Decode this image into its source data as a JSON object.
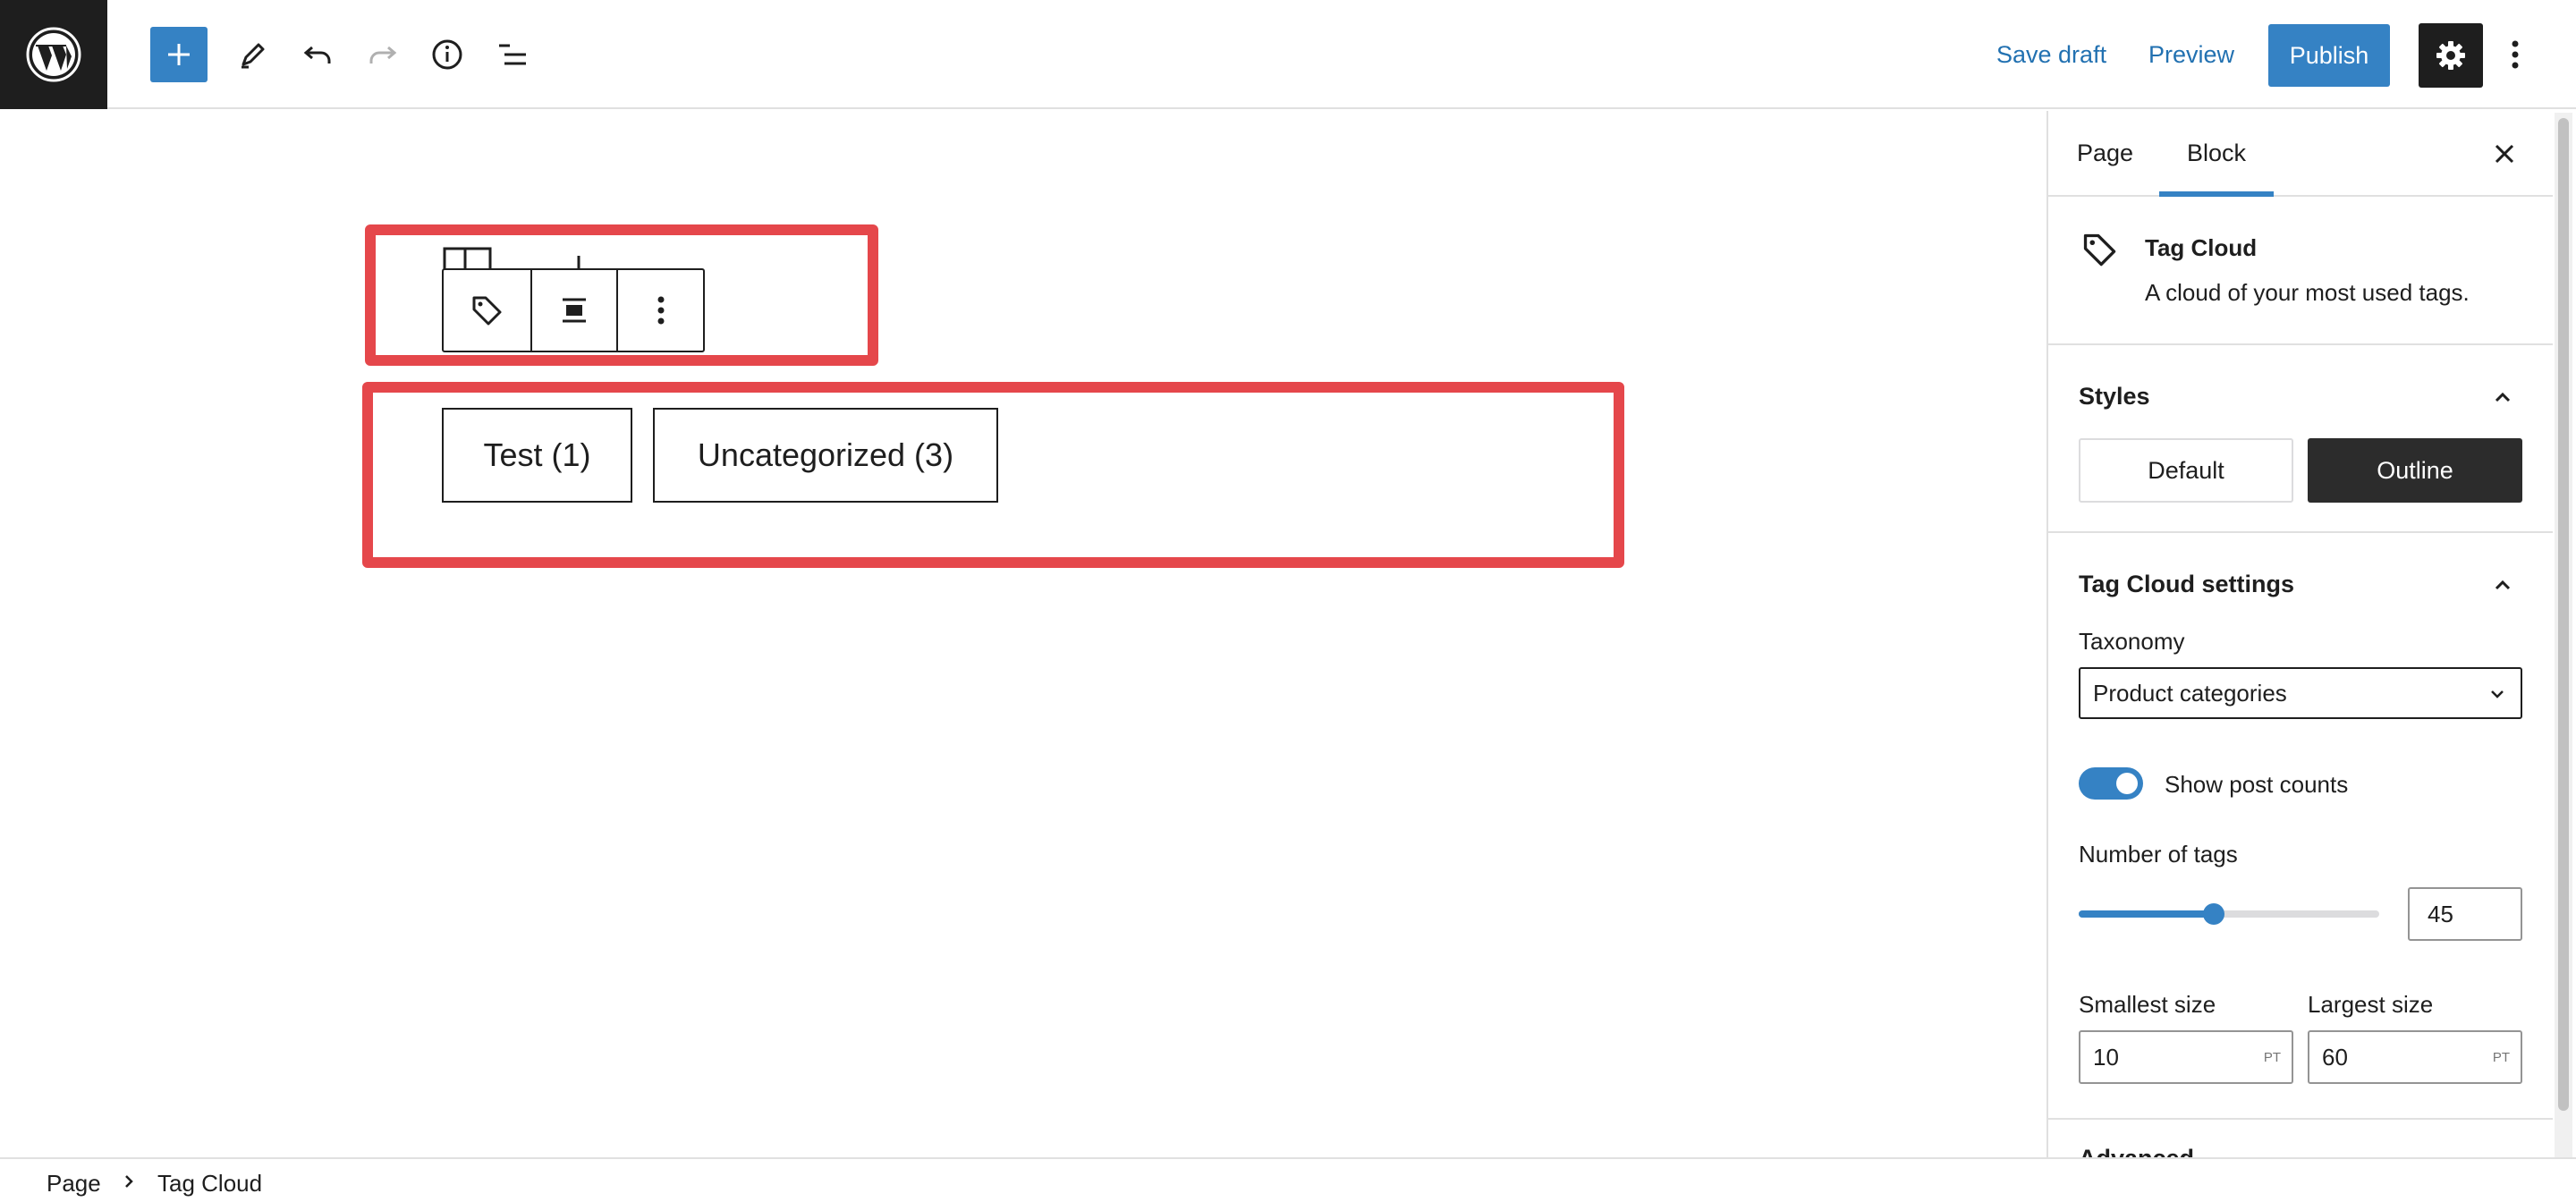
{
  "header": {
    "save_draft": "Save draft",
    "preview": "Preview",
    "publish": "Publish"
  },
  "canvas": {
    "tags": [
      {
        "label": "Test (1)"
      },
      {
        "label": "Uncategorized (3)"
      }
    ]
  },
  "sidebar": {
    "tabs": [
      {
        "label": "Page"
      },
      {
        "label": "Block",
        "active": true
      }
    ],
    "block": {
      "title": "Tag Cloud",
      "description": "A cloud of your most used tags."
    },
    "styles": {
      "heading": "Styles",
      "options": [
        {
          "label": "Default"
        },
        {
          "label": "Outline",
          "selected": true
        }
      ]
    },
    "settings": {
      "heading": "Tag Cloud settings",
      "taxonomy_label": "Taxonomy",
      "taxonomy_value": "Product categories",
      "show_counts_label": "Show post counts",
      "show_counts": true,
      "number_label": "Number of tags",
      "number_value": "45",
      "number_fraction": 0.45,
      "smallest_label": "Smallest size",
      "smallest_value": "10",
      "largest_label": "Largest size",
      "largest_value": "60",
      "unit": "PT"
    },
    "advanced_heading": "Advanced"
  },
  "breadcrumb": {
    "root": "Page",
    "current": "Tag Cloud"
  },
  "colors": {
    "accent": "#3582c4",
    "annotation_red": "#e5474b",
    "dark": "#1e1e1e"
  }
}
